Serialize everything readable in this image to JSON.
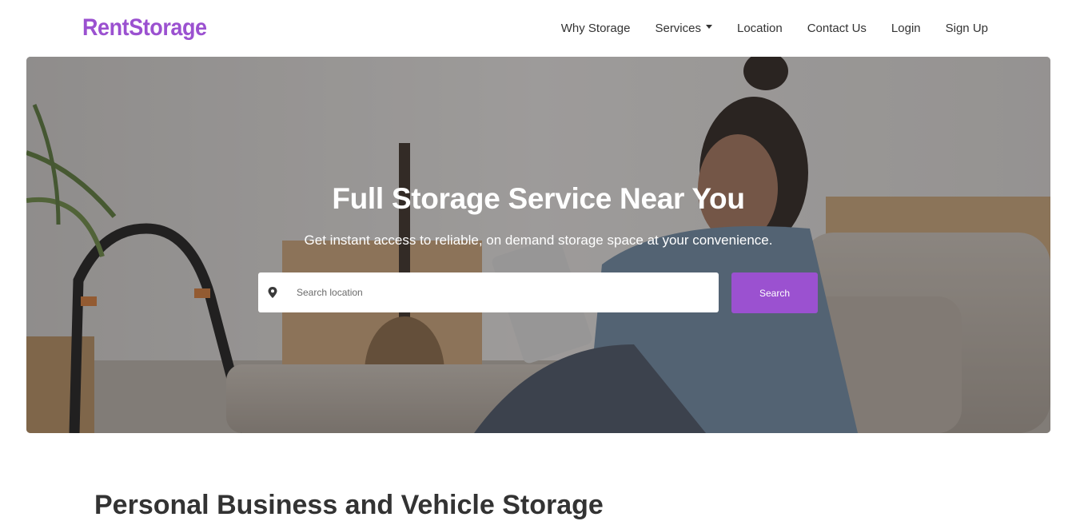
{
  "brand": {
    "name": "RentStorage",
    "color": "#9b51d0"
  },
  "nav": {
    "items": [
      {
        "label": "Why Storage"
      },
      {
        "label": "Services",
        "has_dropdown": true
      },
      {
        "label": "Location"
      },
      {
        "label": "Contact Us"
      },
      {
        "label": "Login"
      },
      {
        "label": "Sign Up"
      }
    ]
  },
  "hero": {
    "title": "Full Storage Service Near You",
    "subtitle": "Get instant access to reliable, on demand storage space at your convenience.",
    "search": {
      "placeholder": "Search location",
      "value": "",
      "icon": "map-pin-icon",
      "button_label": "Search"
    }
  },
  "next_section": {
    "heading": "Personal Business and Vehicle Storage"
  },
  "colors": {
    "accent": "#9b51d0",
    "nav_text": "#333333",
    "hero_text": "#ffffff"
  }
}
